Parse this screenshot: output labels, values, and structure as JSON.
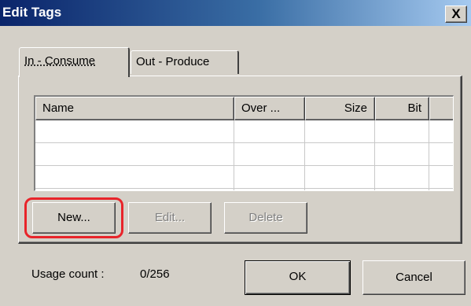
{
  "window": {
    "title": "Edit Tags",
    "close_label": "X"
  },
  "tabs": [
    {
      "label": "In - Consume",
      "selected": true
    },
    {
      "label": "Out - Produce",
      "selected": false
    }
  ],
  "table": {
    "columns": [
      "Name",
      "Over ...",
      "Size",
      "Bit"
    ],
    "rows": []
  },
  "buttons": {
    "new_label": "New...",
    "edit_label": "Edit...",
    "delete_label": "Delete",
    "ok_label": "OK",
    "cancel_label": "Cancel"
  },
  "usage": {
    "label": "Usage count :",
    "value": "0/256"
  },
  "colors": {
    "highlight": "#e8242a",
    "titlebar_start": "#0a246a",
    "face": "#d4d0c8"
  }
}
